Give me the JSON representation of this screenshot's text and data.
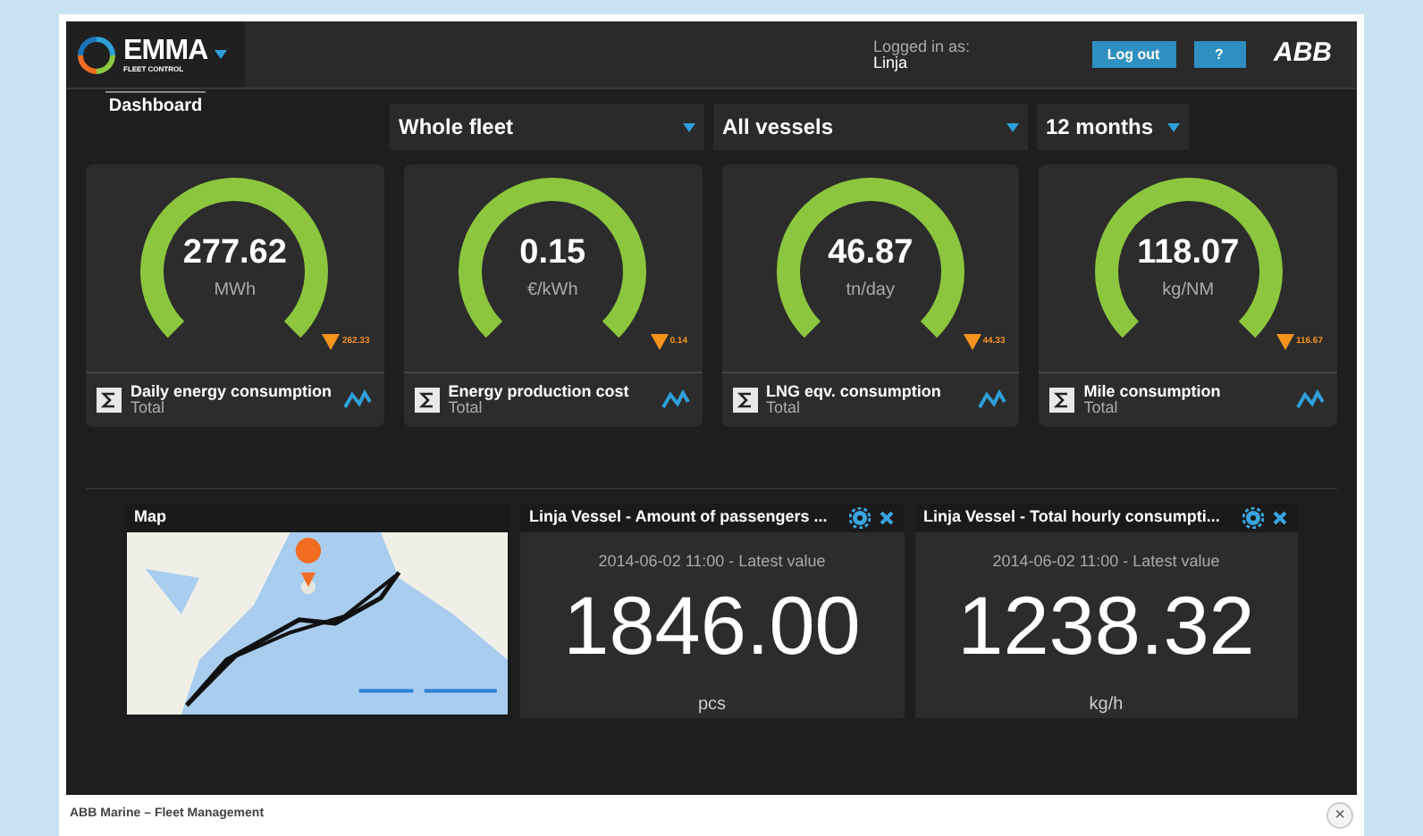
{
  "header": {
    "logo_title": "EMMA",
    "logo_subtitle": "FLEET CONTROL",
    "logged_in_label": "Logged in as:",
    "user": "Linja",
    "buttons": [
      {
        "label": "Log out"
      },
      {
        "label": "?"
      }
    ],
    "brand": "ABB"
  },
  "tabs": [
    {
      "label": "Dashboard",
      "selected": true
    }
  ],
  "filters": [
    {
      "value": "Whole fleet"
    },
    {
      "value": "All vessels"
    },
    {
      "value": "12 months"
    }
  ],
  "gauges": [
    {
      "value": "277.62",
      "unit": "MWh",
      "threshold": "262.33",
      "title": "Daily energy consumption",
      "subtitle": "Total"
    },
    {
      "value": "0.15",
      "unit": "€/kWh",
      "threshold": "0.14",
      "title": "Energy production cost",
      "subtitle": "Total"
    },
    {
      "value": "46.87",
      "unit": "tn/day",
      "threshold": "44.33",
      "title": "LNG eqv. consumption",
      "subtitle": "Total"
    },
    {
      "value": "118.07",
      "unit": "kg/NM",
      "threshold": "116.67",
      "title": "Mile consumption",
      "subtitle": "Total"
    }
  ],
  "map": {
    "title": "Map"
  },
  "widgets": [
    {
      "title": "Linja Vessel - Amount of passengers ...",
      "timestamp": "2014-06-02 11:00 - Latest value",
      "value": "1846.00",
      "unit": "pcs"
    },
    {
      "title": "Linja Vessel - Total hourly consumpti...",
      "timestamp": "2014-06-02 11:00 - Latest value",
      "value": "1238.32",
      "unit": "kg/h"
    }
  ],
  "footer": {
    "caption": "ABB Marine – Fleet Management",
    "close": "×"
  }
}
